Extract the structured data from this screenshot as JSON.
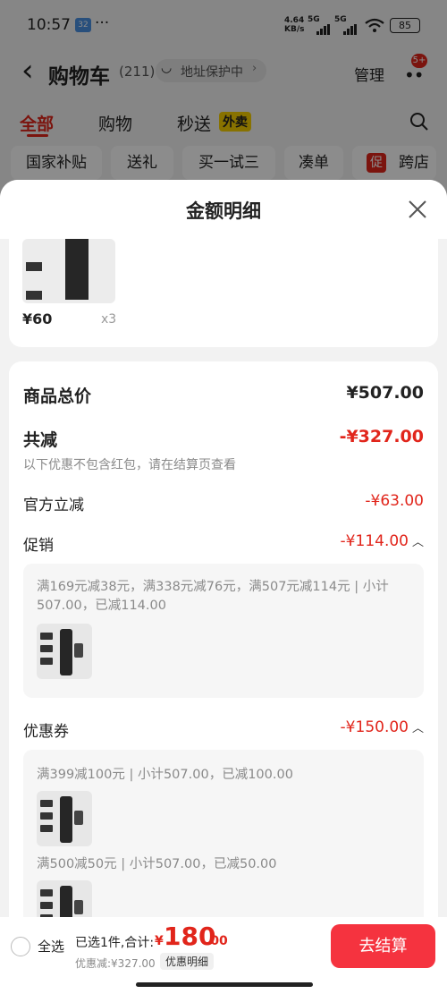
{
  "status": {
    "time": "10:57",
    "weather": "32",
    "dots": "···",
    "net": "4.64\nKB/s",
    "sig1": "5G",
    "sig2": "5G",
    "battery": "85"
  },
  "header": {
    "back": "‹",
    "title": "购物车",
    "count": "(211)",
    "address": "地址保护中",
    "manage": "管理",
    "badge": "5+"
  },
  "tabs": [
    {
      "label": "全部"
    },
    {
      "label": "购物"
    },
    {
      "label": "秒送"
    }
  ],
  "tab_badge": "外卖",
  "filters": [
    "国家补贴",
    "送礼",
    "买一试三",
    "凑单",
    "跨店"
  ],
  "filter_tag": "促",
  "sheet": {
    "title": "金额明细",
    "item": {
      "price": "¥60",
      "qty": "x3"
    },
    "total_label": "商品总价",
    "total_value": "¥507.00",
    "reduce_label": "共减",
    "reduce_value": "-¥327.00",
    "reduce_note": "以下优惠不包含红包，请在结算页查看",
    "official_label": "官方立减",
    "official_value": "-¥63.00",
    "promo_label": "促销",
    "promo_value": "-¥114.00",
    "promo_desc": "满169元减38元，满338元减76元，满507元减114元 | 小计507.00，已减114.00",
    "coupon_label": "优惠券",
    "coupon_value": "-¥150.00",
    "coupon1": "满399减100元 | 小计507.00，已减100.00",
    "coupon2": "满500减50元 | 小计507.00，已减50.00"
  },
  "bottom": {
    "select_all": "全选",
    "selected": "已选1件,合计:",
    "currency": "¥",
    "total_int": "180",
    "total_dec": ".00",
    "discount": "优惠减:¥327.00",
    "detail_btn": "优惠明细",
    "checkout": "去结算"
  },
  "colors": {
    "accent": "#e1251b",
    "checkout_bg": "#f5333f"
  }
}
